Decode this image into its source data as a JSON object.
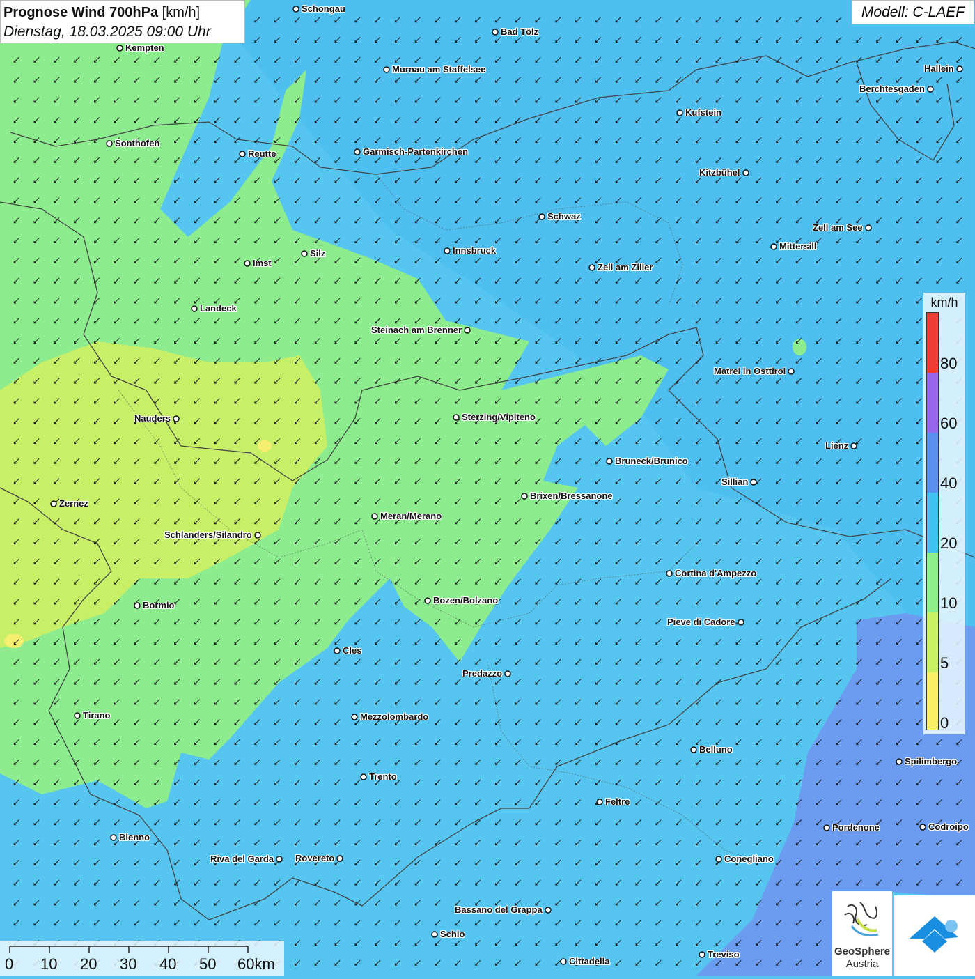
{
  "header": {
    "title_bold": "Prognose Wind 700hPa",
    "title_unit": "[km/h]",
    "datetime": "Dienstag, 18.03.2025 09:00 Uhr",
    "model": "Modell: C-LAEF"
  },
  "legend": {
    "unit": "km/h",
    "ticks": [
      "80",
      "60",
      "40",
      "20",
      "10",
      "5",
      "0"
    ],
    "colors": [
      "#f03c37",
      "#9966ee",
      "#5c8ef0",
      "#3fc2ee",
      "#8fef8a",
      "#c9f060",
      "#f7f065"
    ]
  },
  "scalebar": {
    "labels": [
      "0",
      "10",
      "20",
      "30",
      "40",
      "50",
      "60km"
    ]
  },
  "logos": {
    "geosphere_name": "GeoSphere",
    "geosphere_sub": "Austria"
  },
  "map": {
    "wind_arrow_direction": "from northeast",
    "cities": [
      {
        "name": "Schongau"
      },
      {
        "name": "Bad Tölz"
      },
      {
        "name": "Kempten"
      },
      {
        "name": "Murnau am Staffelsee"
      },
      {
        "name": "Hallein"
      },
      {
        "name": "Berchtesgaden"
      },
      {
        "name": "Kufstein"
      },
      {
        "name": "Sonthofen"
      },
      {
        "name": "Reutte"
      },
      {
        "name": "Garmisch-Partenkirchen"
      },
      {
        "name": "Kitzbühel"
      },
      {
        "name": "Schwaz"
      },
      {
        "name": "Zell am See"
      },
      {
        "name": "Mittersill"
      },
      {
        "name": "Innsbruck"
      },
      {
        "name": "Imst"
      },
      {
        "name": "Silz"
      },
      {
        "name": "Zell am Ziller"
      },
      {
        "name": "Landeck"
      },
      {
        "name": "Steinach am Brenner"
      },
      {
        "name": "Matrei in Osttirol"
      },
      {
        "name": "Nauders"
      },
      {
        "name": "Sterzing/Vipiteno"
      },
      {
        "name": "Lienz"
      },
      {
        "name": "Bruneck/Brunico"
      },
      {
        "name": "Sillian"
      },
      {
        "name": "Brixen/Bressanone"
      },
      {
        "name": "Zernez"
      },
      {
        "name": "Meran/Merano"
      },
      {
        "name": "Schlanders/Silandro"
      },
      {
        "name": "Cortina d'Ampezzo"
      },
      {
        "name": "Bozen/Bolzano"
      },
      {
        "name": "Bormio"
      },
      {
        "name": "Pieve di Cadore"
      },
      {
        "name": "Cles"
      },
      {
        "name": "Predazzo"
      },
      {
        "name": "Tirano"
      },
      {
        "name": "Mezzolombardo"
      },
      {
        "name": "Belluno"
      },
      {
        "name": "Spilimbergo"
      },
      {
        "name": "Trento"
      },
      {
        "name": "Feltre"
      },
      {
        "name": "Pordenone"
      },
      {
        "name": "Codroipo"
      },
      {
        "name": "Bienno"
      },
      {
        "name": "Riva del Garda"
      },
      {
        "name": "Rovereto"
      },
      {
        "name": "Conegliano"
      },
      {
        "name": "Bassano del Grappa"
      },
      {
        "name": "Schio"
      },
      {
        "name": "Treviso"
      },
      {
        "name": "Cittadella"
      }
    ]
  }
}
